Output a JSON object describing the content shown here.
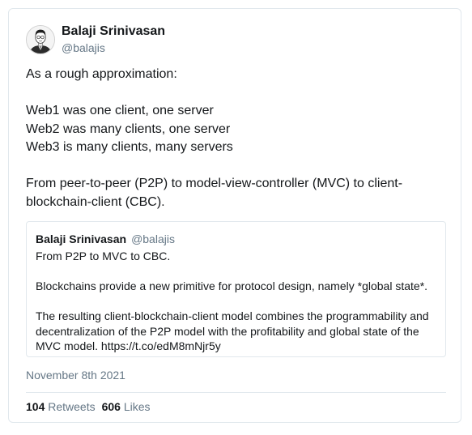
{
  "tweet": {
    "author": {
      "name": "Balaji Srinivasan",
      "handle": "@balajis"
    },
    "lines": [
      "As a rough approximation:",
      "",
      "Web1 was one client, one server",
      "Web2 was many clients, one server",
      "Web3 is many clients, many servers",
      "",
      "From peer-to-peer (P2P) to model-view-controller (MVC) to client-",
      "blockchain-client (CBC)."
    ],
    "date": "November 8th 2021",
    "stats": {
      "retweets_count": "104",
      "retweets_label": "Retweets",
      "likes_count": "606",
      "likes_label": "Likes"
    }
  },
  "quoted": {
    "author": {
      "name": "Balaji Srinivasan",
      "handle": "@balajis"
    },
    "lines": [
      "From P2P to MVC to CBC.",
      "",
      "Blockchains provide a new primitive for protocol design, namely *global state*.",
      "",
      "The resulting client-blockchain-client model combines the programmability and",
      "decentralization of the P2P model with the profitability and global state of the",
      "MVC model. https://t.co/edM8mNjr5y"
    ]
  },
  "icons": {
    "avatar": "avatar-portrait-icon"
  }
}
